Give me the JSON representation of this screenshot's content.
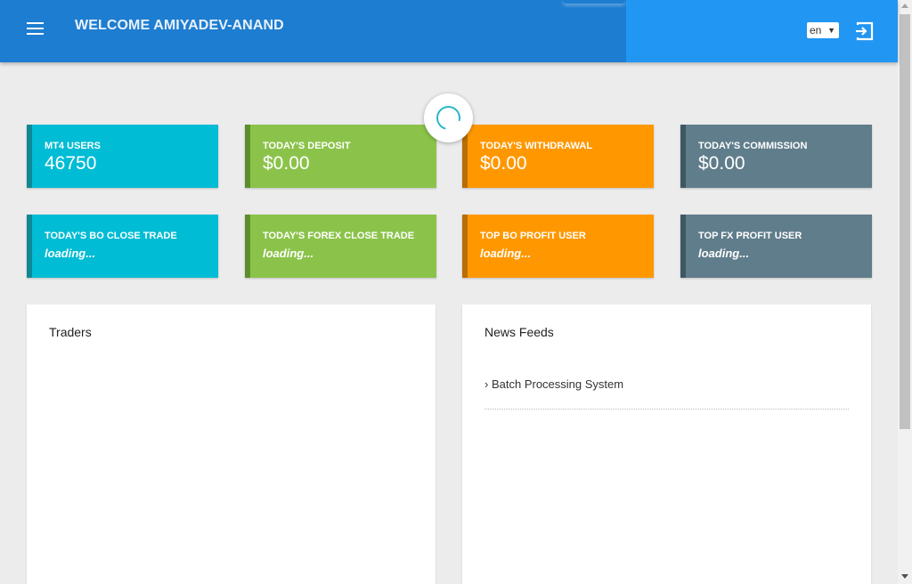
{
  "header": {
    "welcome_text": "WELCOME AMIYADEV-ANAND",
    "language": "en",
    "menu_icon": "hamburger-menu-icon",
    "logout_icon": "logout-icon",
    "colors": {
      "primary": "#1d7dd0",
      "accent": "#2196f3"
    }
  },
  "stats_row1": [
    {
      "label": "MT4 USERS",
      "value": "46750",
      "color": "#00bcd4"
    },
    {
      "label": "TODAY'S DEPOSIT",
      "value": "$0.00",
      "color": "#8bc34a"
    },
    {
      "label": "TODAY'S WITHDRAWAL",
      "value": "$0.00",
      "color": "#ff9800"
    },
    {
      "label": "TODAY'S COMMISSION",
      "value": "$0.00",
      "color": "#607d8b"
    }
  ],
  "stats_row2": [
    {
      "label": "TODAY'S BO CLOSE TRADE",
      "value": "loading...",
      "color": "#00bcd4"
    },
    {
      "label": "TODAY'S FOREX CLOSE TRADE",
      "value": "loading...",
      "color": "#8bc34a"
    },
    {
      "label": "TOP BO PROFIT USER",
      "value": "loading...",
      "color": "#ff9800"
    },
    {
      "label": "TOP FX PROFIT USER",
      "value": "loading...",
      "color": "#607d8b"
    }
  ],
  "traders_panel": {
    "title": "Traders"
  },
  "news_panel": {
    "title": "News Feeds",
    "items": [
      {
        "bullet": "›",
        "text": "Batch Processing System"
      }
    ]
  }
}
